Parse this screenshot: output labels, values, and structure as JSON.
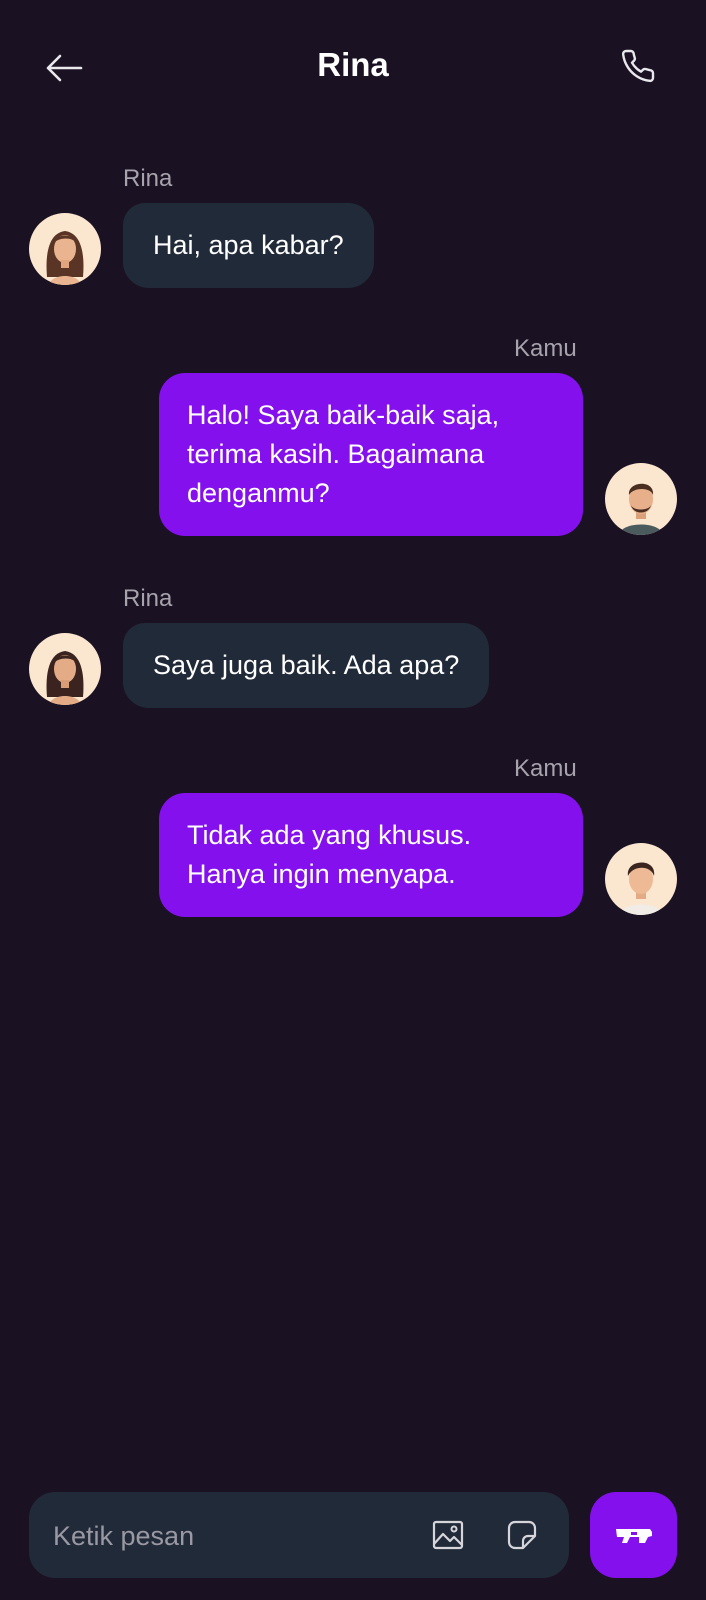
{
  "header": {
    "title": "Rina",
    "back_icon": "arrow-left-icon",
    "call_icon": "phone-icon"
  },
  "messages": [
    {
      "sender": "Rina",
      "direction": "incoming",
      "text": "Hai, apa kabar?"
    },
    {
      "sender": "Kamu",
      "direction": "outgoing",
      "text": "Halo! Saya baik-baik saja, terima kasih. Bagaimana denganmu?"
    },
    {
      "sender": "Rina",
      "direction": "incoming",
      "text": "Saya juga baik. Ada apa?"
    },
    {
      "sender": "Kamu",
      "direction": "outgoing",
      "text": "Tidak ada yang khusus. Hanya ingin menyapa."
    }
  ],
  "composer": {
    "placeholder": "Ketik pesan",
    "value": "",
    "image_icon": "image-icon",
    "sticker_icon": "sticker-icon",
    "send_icon": "send-icon"
  },
  "colors": {
    "background": "#1a1122",
    "incoming_bubble": "#212a38",
    "outgoing_bubble": "#8411ed",
    "accent": "#8411ed",
    "name_text": "#a7a3ad"
  }
}
